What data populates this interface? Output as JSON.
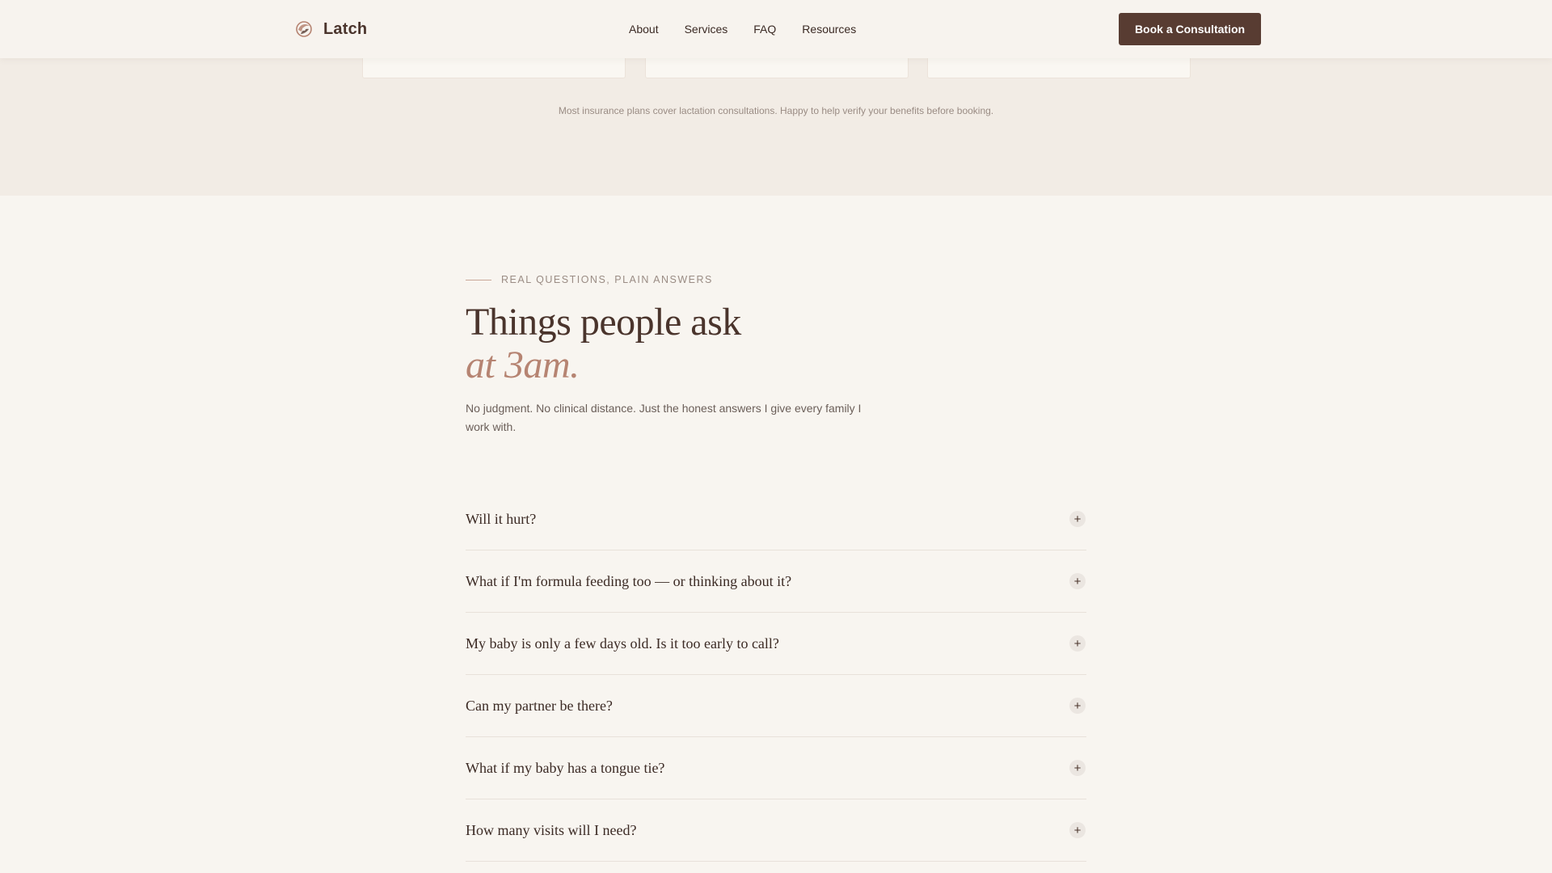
{
  "header": {
    "brand": "Latch",
    "nav": [
      "About",
      "Services",
      "FAQ",
      "Resources"
    ],
    "cta_label": "Book a Consultation"
  },
  "pricing": {
    "insurance_note": "Most insurance plans cover lactation consultations. Happy to help verify your benefits before booking."
  },
  "faq": {
    "eyebrow": "Real questions, plain answers",
    "title_line1": "Things people ask",
    "title_line2": "at 3am.",
    "intro": "No judgment. No clinical distance. Just the honest answers I give every family I work with.",
    "items": [
      {
        "question": "Will it hurt?"
      },
      {
        "question": "What if I'm formula feeding too — or thinking about it?"
      },
      {
        "question": "My baby is only a few days old. Is it too early to call?"
      },
      {
        "question": "Can my partner be there?"
      },
      {
        "question": "What if my baby has a tongue tie?"
      },
      {
        "question": "How many visits will I need?"
      }
    ],
    "expand_glyph": "+"
  },
  "colors": {
    "page_background": "#f8f5f0",
    "band_background": "#f2ece5",
    "brand_dark": "#583c32",
    "accent": "#b68472",
    "heading": "#4a342c",
    "muted_text": "#9a8c84"
  },
  "icons": {
    "logo": "latch-logo-icon",
    "expand": "plus-icon"
  }
}
